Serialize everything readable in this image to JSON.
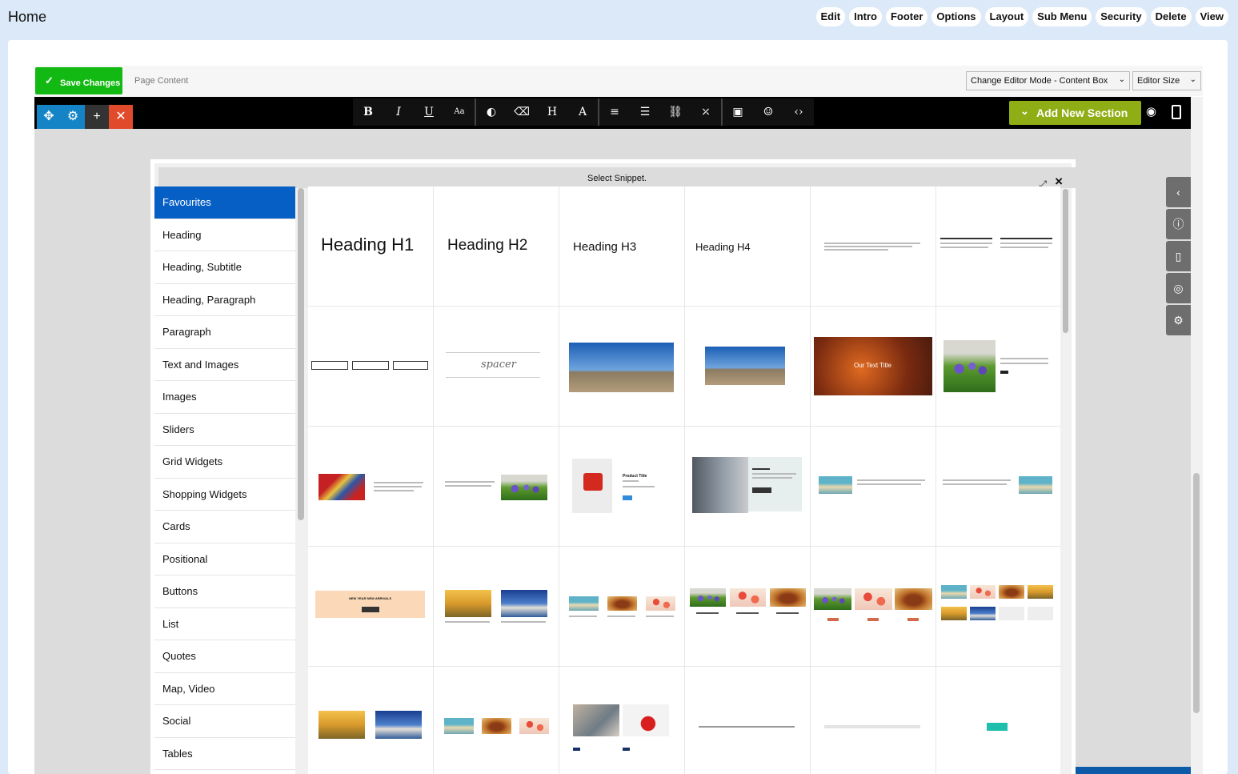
{
  "header": {
    "title": "Home",
    "menu": [
      "Edit",
      "Intro",
      "Footer",
      "Options",
      "Layout",
      "Sub Menu",
      "Security",
      "Delete",
      "View"
    ]
  },
  "toolbar": {
    "save_label": "Save Changes",
    "page_content_label": "Page Content",
    "editor_mode": "Change Editor Mode - Content Box",
    "editor_size": "Editor Size",
    "add_section": "Add New Section"
  },
  "modal": {
    "title": "Select Snippet.",
    "categories": [
      "Favourites",
      "Heading",
      "Heading, Subtitle",
      "Heading, Paragraph",
      "Paragraph",
      "Text and Images",
      "Images",
      "Sliders",
      "Grid Widgets",
      "Shopping Widgets",
      "Cards",
      "Positional",
      "Buttons",
      "List",
      "Quotes",
      "Map, Video",
      "Social",
      "Tables"
    ],
    "active_category": "Favourites",
    "snippets": {
      "h1": "Heading H1",
      "h2": "Heading H2",
      "h3": "Heading H3",
      "h4": "Heading H4",
      "spacer": "spacer",
      "overlay": "Our Text Title",
      "product": "Product Title",
      "arrivals": "NEW YEAR NEW ARRIVALS"
    }
  }
}
